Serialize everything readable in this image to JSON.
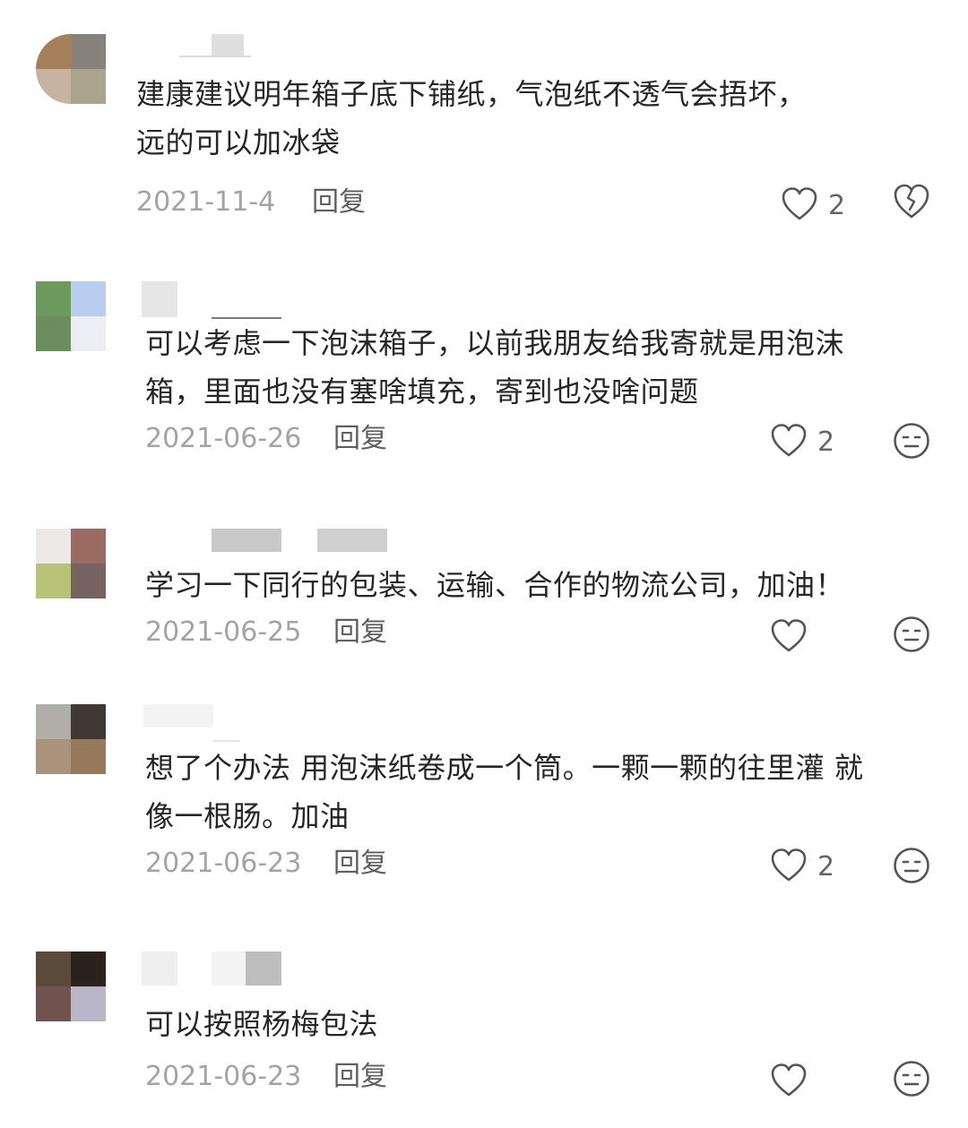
{
  "comments": [
    {
      "text_lines": [
        "建康建议明年箱子底下铺纸，气泡纸不透气会捂坏，",
        "远的可以加冰袋"
      ],
      "date": "2021-11-4",
      "reply_label": "回复",
      "likes": "2",
      "dislike_icon": "broken-heart-icon",
      "avatar_colors": [
        "#a57f57",
        "#86827a",
        "#c6b49e",
        "#a9a48c"
      ]
    },
    {
      "text_lines": [
        "可以考虑一下泡沫箱子，以前我朋友给我寄就是用泡沫",
        "箱，里面也没有塞啥填充，寄到也没啥问题"
      ],
      "date": "2021-06-26",
      "reply_label": "回复",
      "likes": "2",
      "dislike_icon": "meh-face-icon",
      "avatar_colors": [
        "#6c9a5c",
        "#b9cdf0",
        "#6c8d5e",
        "#eceef3"
      ]
    },
    {
      "text_lines": [
        "学习一下同行的包装、运输、合作的物流公司，加油！"
      ],
      "date": "2021-06-25",
      "reply_label": "回复",
      "likes": "",
      "dislike_icon": "meh-face-icon",
      "avatar_colors": [
        "#ece9e6",
        "#9b6b62",
        "#b8c279",
        "#76625f"
      ]
    },
    {
      "text_lines": [
        "想了个办法 用泡沫纸卷成一个筒。一颗一颗的往里灌 就",
        "像一根肠。加油"
      ],
      "date": "2021-06-23",
      "reply_label": "回复",
      "likes": "2",
      "dislike_icon": "meh-face-icon",
      "avatar_colors": [
        "#b1aea6",
        "#3f3934",
        "#a9937a",
        "#967a5b"
      ]
    },
    {
      "text_lines": [
        "可以按照杨梅包法"
      ],
      "date": "2021-06-23",
      "reply_label": "回复",
      "likes": "",
      "dislike_icon": "meh-face-icon",
      "avatar_colors": [
        "#5a4a3a",
        "#2c221c",
        "#70534e",
        "#b9b6c9"
      ]
    }
  ]
}
